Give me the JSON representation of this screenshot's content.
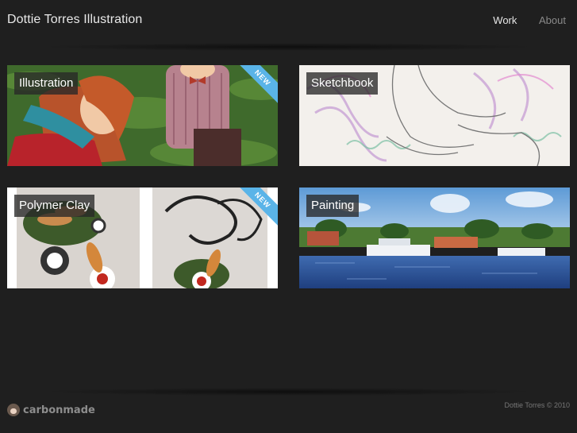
{
  "header": {
    "site_title": "Dottie Torres Illustration",
    "nav": [
      {
        "label": "Work",
        "active": true
      },
      {
        "label": "About",
        "active": false
      }
    ]
  },
  "projects": [
    {
      "label": "Illustration",
      "badge": "NEW"
    },
    {
      "label": "Sketchbook",
      "badge": ""
    },
    {
      "label": "Polymer Clay",
      "badge": "NEW"
    },
    {
      "label": "Painting",
      "badge": ""
    }
  ],
  "footer": {
    "logo_text": "carbonmade",
    "copyright": "Dottie Torres © 2010"
  },
  "colors": {
    "background": "#1f1f1f",
    "ribbon": "#5ab4e8"
  }
}
